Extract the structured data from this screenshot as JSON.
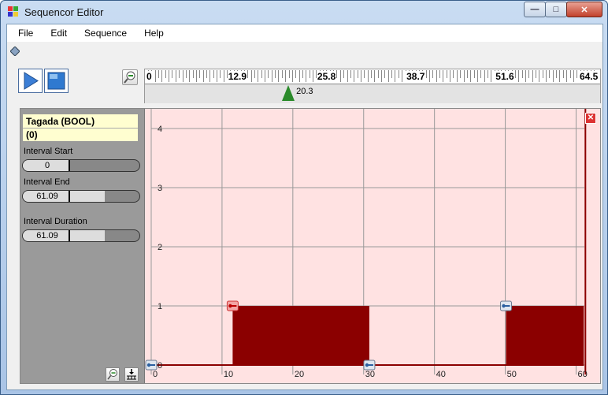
{
  "window": {
    "title": "Sequencor Editor",
    "controls": {
      "minimize": "—",
      "maximize": "□",
      "close": "✕"
    }
  },
  "menu": {
    "items": [
      "File",
      "Edit",
      "Sequence",
      "Help"
    ]
  },
  "toolbar": {
    "play_icon": "play-icon",
    "stop_icon": "stop-icon",
    "zoom_icon": "zoom-out-icon"
  },
  "ruler": {
    "labels": [
      "0",
      "12.9",
      "25.8",
      "38.7",
      "51.6",
      "64.5"
    ],
    "max": 64.5,
    "cursor_value": 20.3,
    "cursor_label": "20.3",
    "marker_color": "#2a8a2a"
  },
  "track": {
    "name": "Tagada (BOOL)",
    "value": "(0)",
    "interval_start_label": "Interval Start",
    "interval_start_value": "0",
    "interval_end_label": "Interval End",
    "interval_end_value": "61.09",
    "interval_duration_label": "Interval Duration",
    "interval_duration_value": "61.09",
    "interval_end_fill": 0.75,
    "interval_duration_fill": 0.75,
    "zoom_button_icon": "zoom-out-icon",
    "fit_button_icon": "fit-icon"
  },
  "plot": {
    "background": "#ffe2e2",
    "bar_color": "#8b0000",
    "grid_color": "#999999",
    "x_labels": [
      "0",
      "10",
      "20",
      "30",
      "40",
      "50",
      "60"
    ],
    "y_labels": [
      "0",
      "1",
      "2",
      "3",
      "4"
    ],
    "x_min": 0,
    "x_max": 61.09,
    "y_max": 4.3,
    "intervals": [
      {
        "start": 11.5,
        "end": 30.8,
        "value": 1
      },
      {
        "start": 50.1,
        "end": 61.09,
        "value": 1
      }
    ],
    "keyframes": [
      {
        "x": 0,
        "value": 0,
        "kind": "blue"
      },
      {
        "x": 11.5,
        "value": 1,
        "kind": "red"
      },
      {
        "x": 30.8,
        "value": 0,
        "kind": "blue"
      },
      {
        "x": 50.1,
        "value": 1,
        "kind": "blue"
      }
    ],
    "close_icon": "close-icon"
  }
}
